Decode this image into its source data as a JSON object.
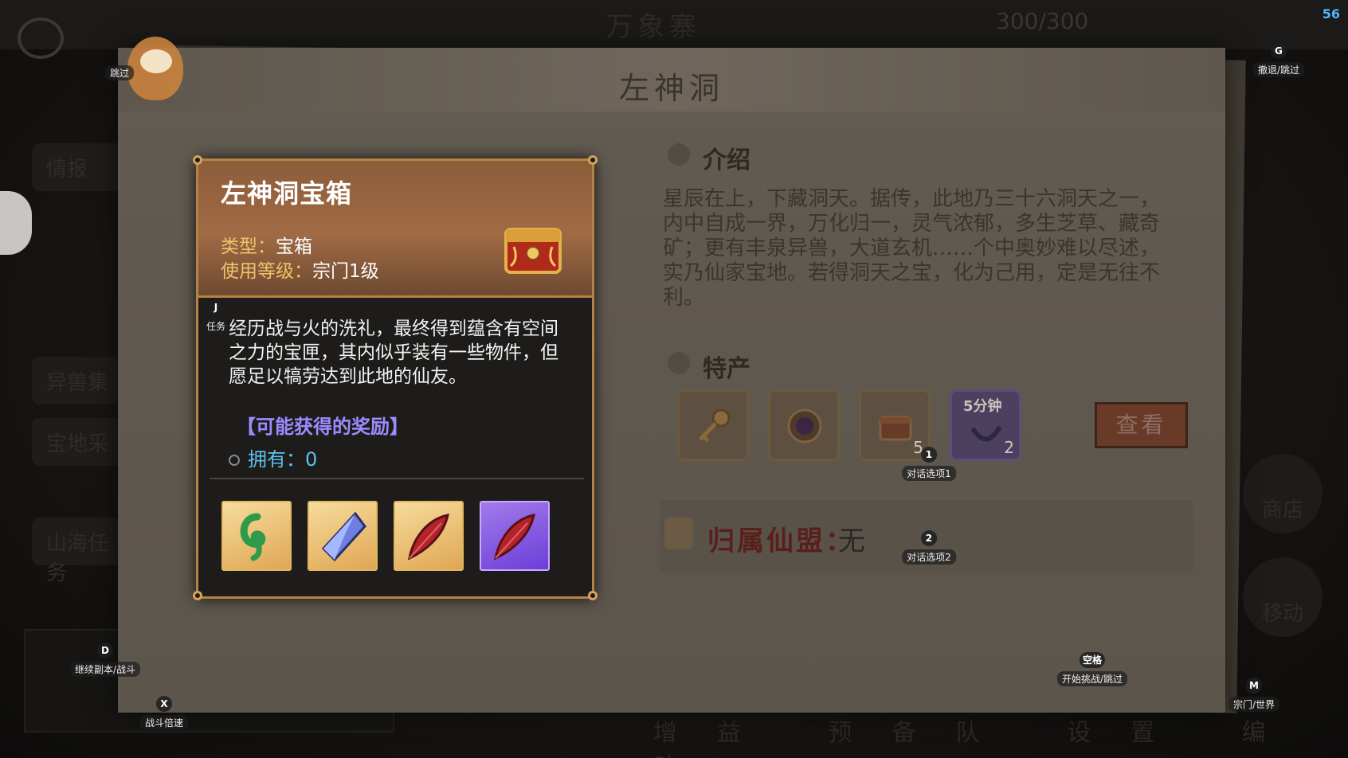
{
  "background": {
    "title": "万象寨",
    "energy": "300/300",
    "left_menu": [
      "情报",
      "异兽集",
      "宝地采",
      "山海任务"
    ],
    "right_menu": [
      "商店",
      "移动"
    ],
    "bottom_menu": [
      "增益",
      "预备队",
      "设置",
      "编队"
    ]
  },
  "panel": {
    "title": "左神洞",
    "intro_heading": "介绍",
    "intro_text": "星辰在上，下藏洞天。据传，此地乃三十六洞天之一，内中自成一界，万化归一，灵气浓郁，多生芝草、藏奇矿；更有丰泉异兽，大道玄机……个中奥妙难以尽述，实乃仙家宝地。若得洞天之宝，化为己用，定是无往不利。",
    "specialty_heading": "特产",
    "specialties": [
      {
        "icon": "key-icon",
        "count": ""
      },
      {
        "icon": "orb-icon",
        "count": ""
      },
      {
        "icon": "chest-icon",
        "count": "5"
      },
      {
        "icon": "scroll-icon",
        "count": "2",
        "tag": "5分钟"
      }
    ],
    "view_button": "查看",
    "alliance_label": "归属仙盟：",
    "alliance_value": "无"
  },
  "popup": {
    "title": "左神洞宝箱",
    "type_key": "类型：",
    "type_value": "宝箱",
    "level_key": "使用等级：",
    "level_value": "宗门1级",
    "description": "经历战与火的洗礼，最终得到蕴含有空间之力的宝匣，其内似乎装有一些物件，但愿足以犒劳达到此地的仙友。",
    "rewards_title": "【可能获得的奖励】",
    "own_label": "拥有：",
    "own_value": "0",
    "rewards": [
      {
        "icon": "jade-icon",
        "rarity": "gold"
      },
      {
        "icon": "crystal-icon",
        "rarity": "gold"
      },
      {
        "icon": "red-feather-icon",
        "rarity": "gold"
      },
      {
        "icon": "red-feather-icon",
        "rarity": "purple"
      }
    ]
  },
  "hints": {
    "skip": {
      "key": "",
      "label": "跳过"
    },
    "retreat": {
      "key": "G",
      "label": "撤退/跳过"
    },
    "task": {
      "key": "J",
      "label": "任务"
    },
    "option1": {
      "key": "1",
      "label": "对话选项1"
    },
    "option2": {
      "key": "2",
      "label": "对话选项2"
    },
    "continue": {
      "key": "D",
      "label": "继续副本/战斗"
    },
    "speed": {
      "key": "X",
      "label": "战斗倍速"
    },
    "start": {
      "key": "空格",
      "label": "开始挑战/跳过"
    },
    "world": {
      "key": "M",
      "label": "宗门/世界"
    }
  },
  "fps": "56"
}
